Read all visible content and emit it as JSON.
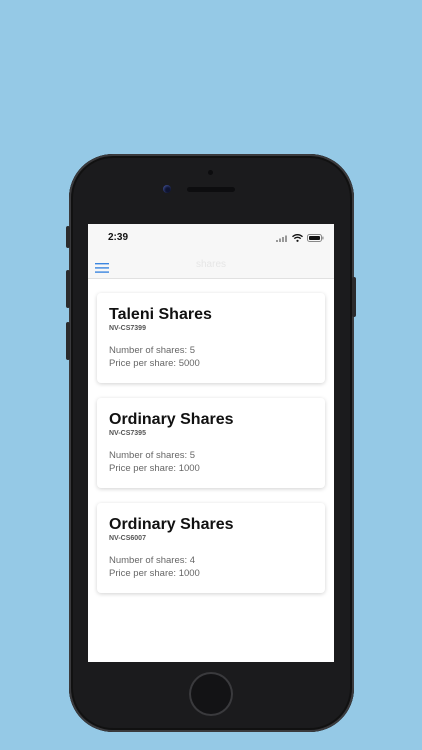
{
  "status_bar": {
    "time": "2:39"
  },
  "nav": {
    "title": "shares",
    "menu_icon": "hamburger-menu-icon"
  },
  "colors": {
    "background": "#95c9e6",
    "accent": "#3b86e0"
  },
  "shares": [
    {
      "title": "Taleni Shares",
      "code": "NV-CS7399",
      "number_label": "Number of shares: 5",
      "price_label": "Price per share: 5000"
    },
    {
      "title": "Ordinary Shares",
      "code": "NV-CS7395",
      "number_label": "Number of shares: 5",
      "price_label": "Price per share: 1000"
    },
    {
      "title": "Ordinary Shares",
      "code": "NV-CS6007",
      "number_label": "Number of shares: 4",
      "price_label": "Price per share: 1000"
    }
  ]
}
